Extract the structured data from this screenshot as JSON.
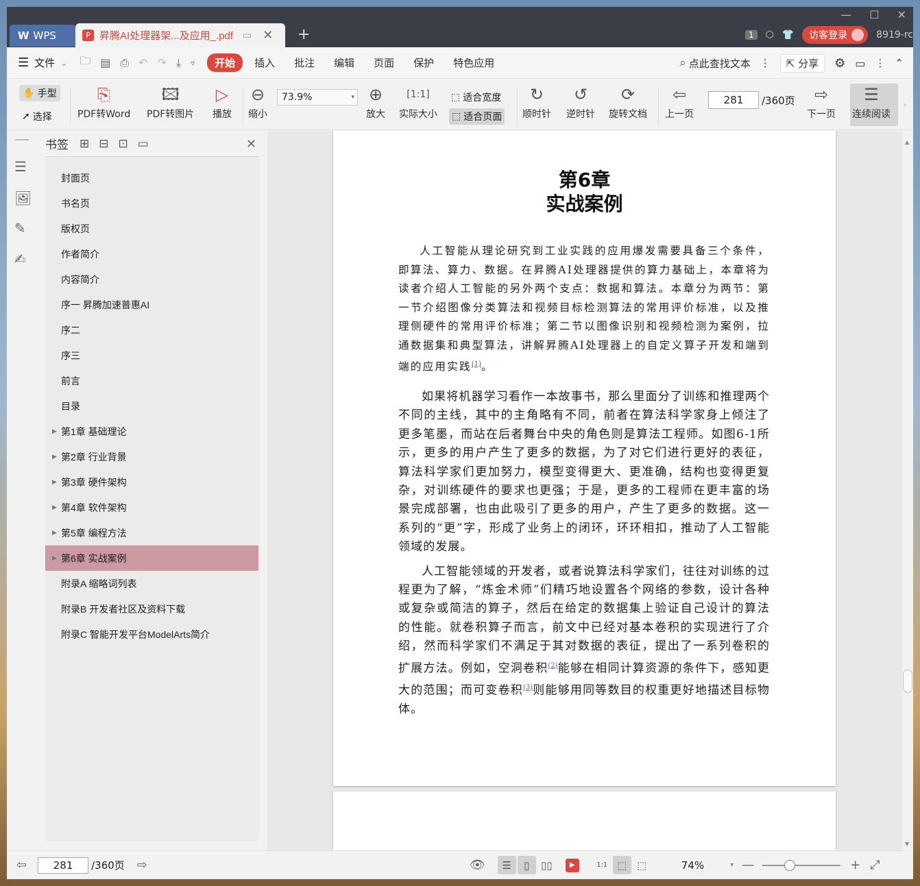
{
  "tabs": {
    "app_label": "WPS",
    "doc_title": "昇腾AI处理器架...及应用_.pdf",
    "add_tab": "+"
  },
  "titlebar": {
    "page_badge": "1",
    "login_label": "访客登录",
    "user_id": "8919-rc"
  },
  "menubar": {
    "file_label": "文件",
    "tabs": [
      "开始",
      "插入",
      "批注",
      "编辑",
      "页面",
      "保护",
      "特色应用"
    ],
    "search_label": "点此查找文本",
    "share_label": "分享"
  },
  "ribbon": {
    "hand_label": "手型",
    "select_label": "选择",
    "pdf_to_word": "PDF转Word",
    "pdf_to_image": "PDF转图片",
    "play": "播放",
    "zoom_out": "缩小",
    "zoom_value": "73.9%",
    "zoom_in": "放大",
    "actual_size": "实际大小",
    "fit_width": "适合宽度",
    "fit_page": "适合页面",
    "rotate_cw": "顺时针",
    "rotate_ccw": "逆时针",
    "rotate_doc": "旋转文档",
    "prev_page": "上一页",
    "page_current": "281",
    "page_total": "/360页",
    "next_page": "下一页",
    "continuous": "连续阅读"
  },
  "bookmarks": {
    "title": "书签",
    "items": [
      {
        "label": "封面页",
        "expandable": false
      },
      {
        "label": "书名页",
        "expandable": false
      },
      {
        "label": "版权页",
        "expandable": false
      },
      {
        "label": "作者简介",
        "expandable": false
      },
      {
        "label": "内容简介",
        "expandable": false
      },
      {
        "label": "序一 昇腾加速普惠AI",
        "expandable": false
      },
      {
        "label": "序二",
        "expandable": false
      },
      {
        "label": "序三",
        "expandable": false
      },
      {
        "label": "前言",
        "expandable": false
      },
      {
        "label": "目录",
        "expandable": false
      },
      {
        "label": "第1章 基础理论",
        "expandable": true
      },
      {
        "label": "第2章 行业背景",
        "expandable": true
      },
      {
        "label": "第3章 硬件架构",
        "expandable": true
      },
      {
        "label": "第4章 软件架构",
        "expandable": true
      },
      {
        "label": "第5章 编程方法",
        "expandable": true
      },
      {
        "label": "第6章 实战案例",
        "expandable": true,
        "selected": true
      },
      {
        "label": "附录A 缩略词列表",
        "expandable": false
      },
      {
        "label": "附录B 开发者社区及资料下载",
        "expandable": false
      },
      {
        "label": "附录C 智能开发平台ModelArts简介",
        "expandable": false
      }
    ]
  },
  "document": {
    "chapter_number": "第6章",
    "chapter_title": "实战案例",
    "intro": "人工智能从理论研究到工业实践的应用爆发需要具备三个条件，即算法、算力、数据。在昇腾AI处理器提供的算力基础上，本章将为读者介绍人工智能的另外两个支点：数据和算法。本章分为两节：第一节介绍图像分类算法和视频目标检测算法的常用评价标准，以及推理侧硬件的常用评价标准；第二节以图像识别和视频检测为案例，拉通数据集和典型算法，讲解昇腾AI处理器上的自定义算子开发和端到端的应用实践",
    "intro_fn": "(1)",
    "intro_end": "。",
    "p1": "如果将机器学习看作一本故事书，那么里面分了训练和推理两个不同的主线，其中的主角略有不同，前者在算法科学家身上倾注了更多笔墨，而站在后者舞台中央的角色则是算法工程师。如图6-1所示，更多的用户产生了更多的数据，为了对它们进行更好的表征，算法科学家们更加努力，模型变得更大、更准确，结构也变得更复杂，对训练硬件的要求也更强；于是，更多的工程师在更丰富的场景完成部署，也由此吸引了更多的用户，产生了更多的数据。这一系列的“更”字，形成了业务上的闭环，环环相扣，推动了人工智能领域的发展。",
    "p2a": "人工智能领域的开发者，或者说算法科学家们，往往对训练的过程更为了解，“炼金术师”们精巧地设置各个网络的参数，设计各种或复杂或简洁的算子，然后在给定的数据集上验证自己设计的算法的性能。就卷积算子而言，前文中已经对基本卷积的实现进行了介绍，然而科学家们不满足于其对数据的表征，提出了一系列卷积的扩展方法。例如，空洞卷积",
    "p2_fn2": "(2)",
    "p2b": "能够在相同计算资源的条件下，感知更大的范围；而可变卷积",
    "p2_fn3": "(3)",
    "p2c": "则能够用同等数目的权重更好地描述目标物体。"
  },
  "statusbar": {
    "page_current": "281",
    "page_total": "/360页",
    "zoom": "74%"
  }
}
